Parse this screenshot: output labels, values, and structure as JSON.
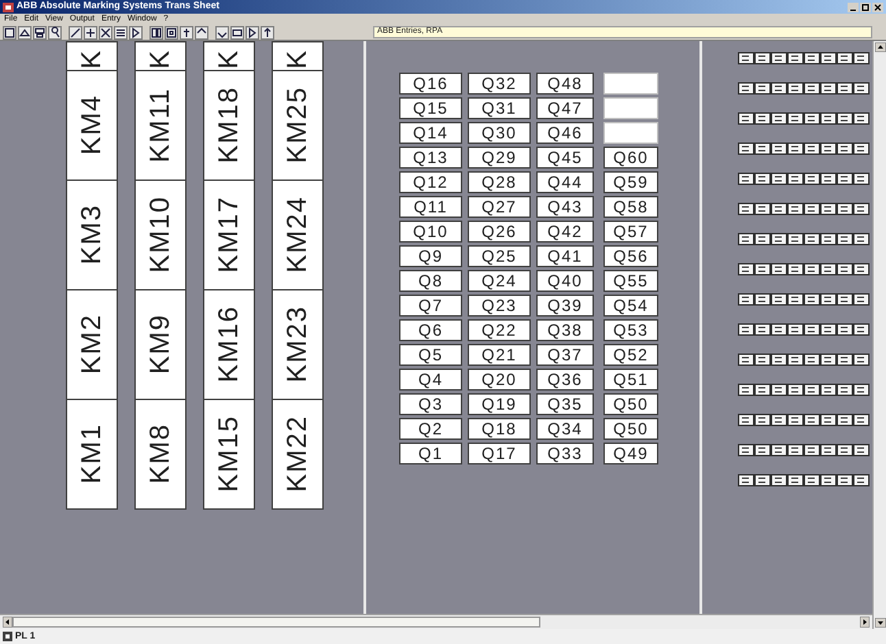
{
  "window": {
    "title": "ABB Absolute Marking Systems Trans Sheet"
  },
  "menu": [
    "File",
    "Edit",
    "View",
    "Output",
    "Entry",
    "Window",
    "?"
  ],
  "entry_field": {
    "value": "ABB Entries, RPA"
  },
  "km_columns": [
    {
      "partial": "K",
      "labels": [
        "KM4",
        "KM3",
        "KM2",
        "KM1"
      ]
    },
    {
      "partial": "K",
      "labels": [
        "KM11",
        "KM10",
        "KM9",
        "KM8"
      ]
    },
    {
      "partial": "K",
      "labels": [
        "KM18",
        "KM17",
        "KM16",
        "KM15"
      ]
    },
    {
      "partial": "K",
      "labels": [
        "KM25",
        "KM24",
        "KM23",
        "KM22"
      ]
    }
  ],
  "q_rows": [
    [
      "Q16",
      "Q32",
      "Q48",
      null
    ],
    [
      "Q15",
      "Q31",
      "Q47",
      null
    ],
    [
      "Q14",
      "Q30",
      "Q46",
      null
    ],
    [
      "Q13",
      "Q29",
      "Q45",
      "Q60"
    ],
    [
      "Q12",
      "Q28",
      "Q44",
      "Q59"
    ],
    [
      "Q11",
      "Q27",
      "Q43",
      "Q58"
    ],
    [
      "Q10",
      "Q26",
      "Q42",
      "Q57"
    ],
    [
      "Q9",
      "Q25",
      "Q41",
      "Q56"
    ],
    [
      "Q8",
      "Q24",
      "Q40",
      "Q55"
    ],
    [
      "Q7",
      "Q23",
      "Q39",
      "Q54"
    ],
    [
      "Q6",
      "Q22",
      "Q38",
      "Q53"
    ],
    [
      "Q5",
      "Q21",
      "Q37",
      "Q52"
    ],
    [
      "Q4",
      "Q20",
      "Q36",
      "Q51"
    ],
    [
      "Q3",
      "Q19",
      "Q35",
      "Q50"
    ],
    [
      "Q2",
      "Q18",
      "Q34",
      "Q50"
    ],
    [
      "Q1",
      "Q17",
      "Q33",
      "Q49"
    ]
  ],
  "status_bar": {
    "text": "PL 1"
  }
}
